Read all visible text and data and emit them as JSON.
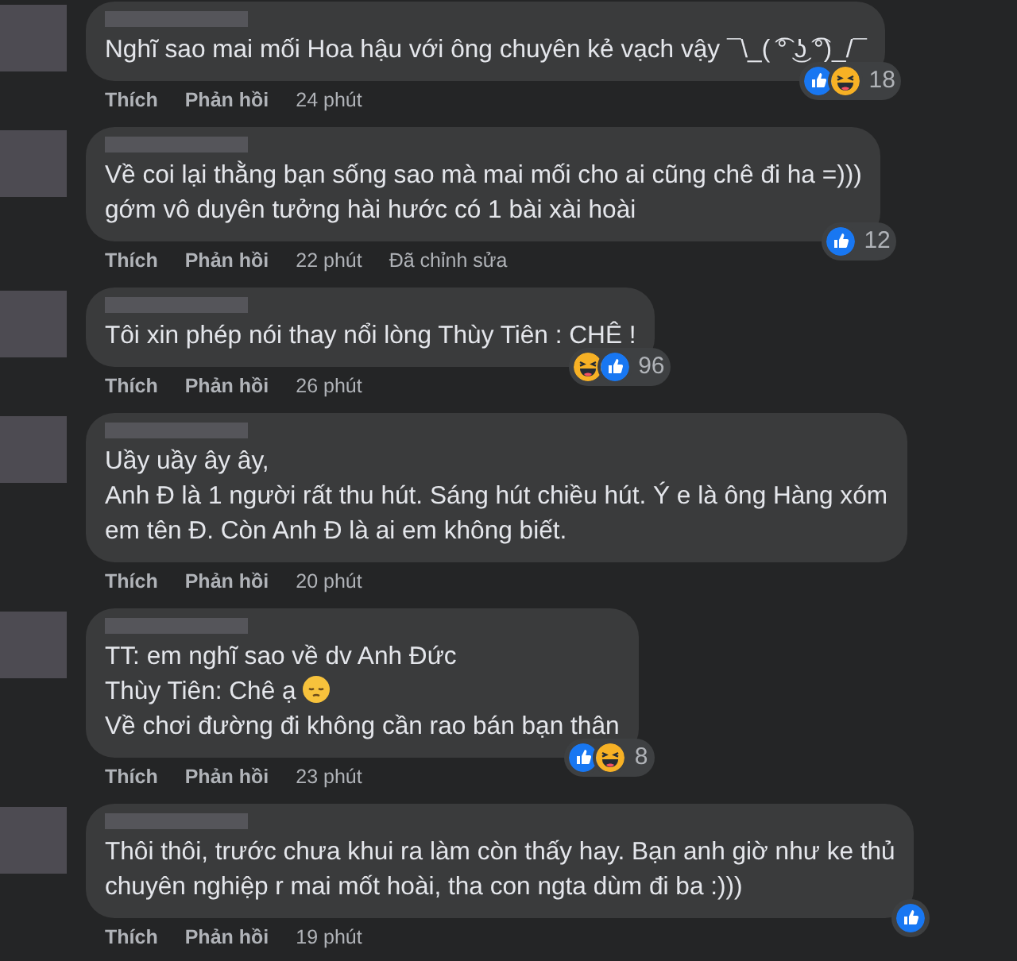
{
  "comments": [
    {
      "lines": [
        {
          "text": "Nghĩ sao mai mối Hoa hậu với ông chuyên kẻ vạch vậy ¯\\_( ͡° ͜ʖ ͡°)_/¯"
        }
      ],
      "actions": {
        "like": "Thích",
        "reply": "Phản hồi",
        "time": "24 phút"
      },
      "reactions": {
        "types": [
          {
            "kind": "like"
          },
          {
            "kind": "haha"
          }
        ],
        "count": "18"
      }
    },
    {
      "lines": [
        {
          "text": "Về coi lại thằng bạn sống sao mà mai mối cho ai cũng chê đi ha =)))"
        },
        {
          "text": "gớm vô duyên tưởng hài hước có 1 bài xài hoài"
        }
      ],
      "actions": {
        "like": "Thích",
        "reply": "Phản hồi",
        "time": "22 phút",
        "edited": "Đã chỉnh sửa"
      },
      "reactions": {
        "types": [
          {
            "kind": "like"
          }
        ],
        "count": "12"
      }
    },
    {
      "lines": [
        {
          "text": "Tôi xin phép nói thay nổi lòng Thùy Tiên : CHÊ !"
        }
      ],
      "actions": {
        "like": "Thích",
        "reply": "Phản hồi",
        "time": "26 phút"
      },
      "reactions": {
        "types": [
          {
            "kind": "haha"
          },
          {
            "kind": "like"
          }
        ],
        "count": "96"
      }
    },
    {
      "lines": [
        {
          "text": "Uầy uầy ây ây,"
        },
        {
          "text": "Anh Đ là 1 người rất thu hút. Sáng hút chiều hút. Ý e là ông Hàng xóm"
        },
        {
          "text": "em tên Đ. Còn Anh Đ là ai em không biết."
        }
      ],
      "actions": {
        "like": "Thích",
        "reply": "Phản hồi",
        "time": "20 phút"
      }
    },
    {
      "lines": [
        {
          "text": "TT: em nghĩ sao về dv Anh Đức"
        },
        {
          "text": "Thùy Tiên: Chê ạ",
          "emoji": true
        },
        {
          "text": "Về chơi đường đi không cần rao bán bạn thân"
        }
      ],
      "actions": {
        "like": "Thích",
        "reply": "Phản hồi",
        "time": "23 phút"
      },
      "reactions": {
        "types": [
          {
            "kind": "like"
          },
          {
            "kind": "haha"
          }
        ],
        "count": "8"
      }
    },
    {
      "lines": [
        {
          "text": "Thôi thôi, trước chưa khui ra làm còn thấy hay. Bạn anh giờ như ke thủ"
        },
        {
          "text": "chuyên nghiệp r mai mốt hoài, tha con ngta dùm đi ba :)))"
        }
      ],
      "actions": {
        "like": "Thích",
        "reply": "Phản hồi",
        "time": "19 phút"
      },
      "reactions": {
        "types": [
          {
            "kind": "like"
          }
        ]
      }
    }
  ]
}
